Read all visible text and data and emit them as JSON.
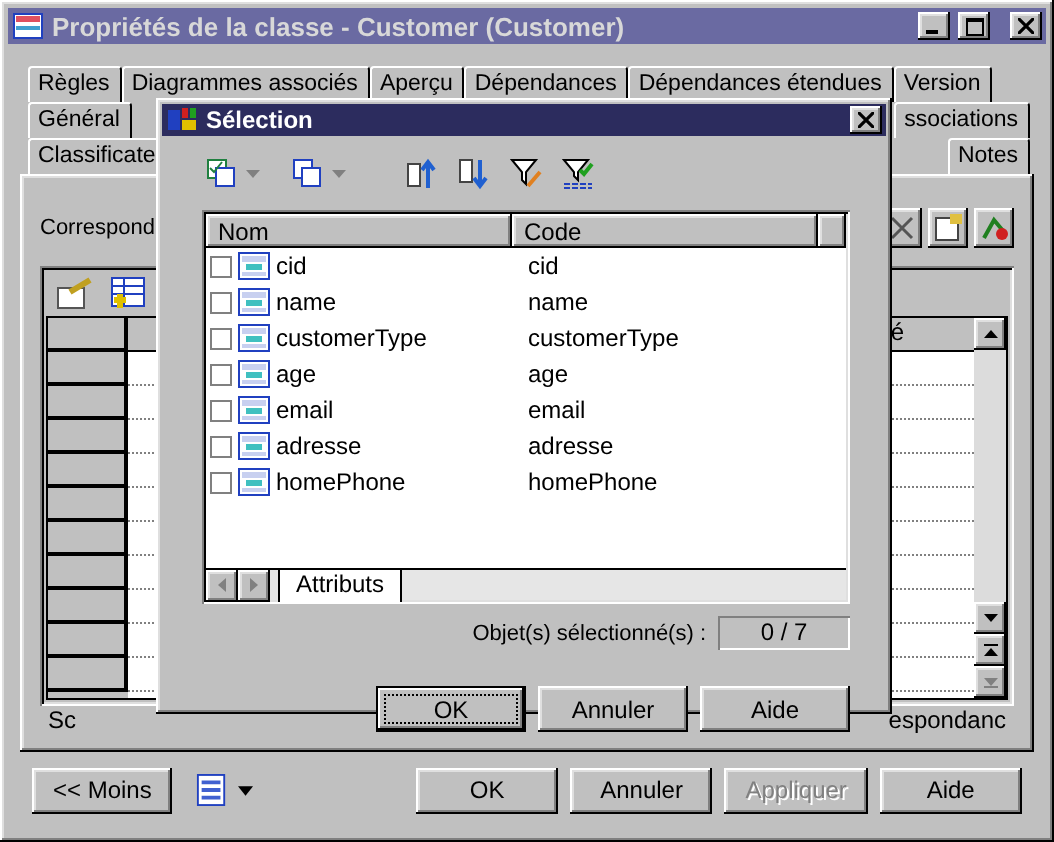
{
  "window": {
    "title": "Propriétés de la classe - Customer (Customer)"
  },
  "tab_rows": [
    [
      {
        "label": "Règles"
      },
      {
        "label": "Diagrammes associés"
      },
      {
        "label": "Aperçu"
      },
      {
        "label": "Dépendances"
      },
      {
        "label": "Dépendances étendues"
      },
      {
        "label": "Version"
      }
    ],
    [
      {
        "label": "Général"
      },
      {
        "label": "ssociations"
      }
    ],
    [
      {
        "label": "Classificate"
      },
      {
        "label": "Notes"
      }
    ]
  ],
  "panel": {
    "label": "Correspond",
    "grid_column": "é",
    "subtabs": [
      "Sc",
      "espondanc"
    ]
  },
  "footer_buttons": [
    {
      "label": "<< Moins",
      "disabled": false
    },
    {
      "label": "OK",
      "disabled": false
    },
    {
      "label": "Annuler",
      "disabled": false
    },
    {
      "label": "Appliquer",
      "disabled": true
    },
    {
      "label": "Aide",
      "disabled": false
    }
  ],
  "dialog": {
    "title": "Sélection",
    "columns": [
      "Nom",
      "Code"
    ],
    "rows": [
      {
        "name": "cid",
        "code": "cid",
        "checked": false
      },
      {
        "name": "name",
        "code": "name",
        "checked": false
      },
      {
        "name": "customerType",
        "code": "customerType",
        "checked": false
      },
      {
        "name": "age",
        "code": "age",
        "checked": false
      },
      {
        "name": "email",
        "code": "email",
        "checked": false
      },
      {
        "name": "adresse",
        "code": "adresse",
        "checked": false
      },
      {
        "name": "homePhone",
        "code": "homePhone",
        "checked": false
      }
    ],
    "list_tab": "Attributs",
    "count_label": "Objet(s) sélectionné(s) :",
    "count": "0 / 7",
    "buttons": [
      {
        "label": "OK",
        "default": true
      },
      {
        "label": "Annuler",
        "default": false
      },
      {
        "label": "Aide",
        "default": false
      }
    ]
  }
}
